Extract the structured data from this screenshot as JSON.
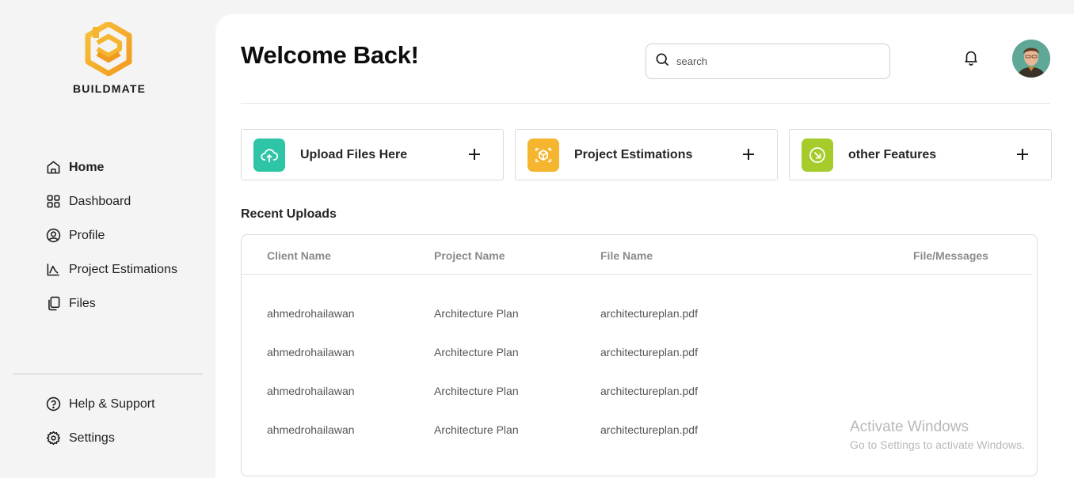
{
  "app": {
    "brand": "BUILDMATE"
  },
  "sidebar": {
    "items": [
      {
        "label": "Home",
        "icon": "home-icon",
        "active": true
      },
      {
        "label": "Dashboard",
        "icon": "dashboard-grid-icon"
      },
      {
        "label": "Profile",
        "icon": "user-circle-icon"
      },
      {
        "label": "Project Estimations",
        "icon": "chart-icon"
      },
      {
        "label": "Files",
        "icon": "files-icon"
      }
    ],
    "bottom_items": [
      {
        "label": "Help & Support",
        "icon": "help-circle-icon"
      },
      {
        "label": "Settings",
        "icon": "gear-icon"
      }
    ]
  },
  "header": {
    "title": "Welcome Back!",
    "search_placeholder": "search"
  },
  "cards": [
    {
      "label": "Upload Files Here",
      "icon": "cloud-upload-icon",
      "color": "#2ec4a6"
    },
    {
      "label": "Project Estimations",
      "icon": "cube-scan-icon",
      "color": "#f5b52e"
    },
    {
      "label": "other Features",
      "icon": "arrow-down-right-circle-icon",
      "color": "#a5cc2a"
    }
  ],
  "recent": {
    "title": "Recent Uploads",
    "columns": [
      "Client Name",
      "Project Name",
      "File Name",
      "File/Messages"
    ],
    "rows": [
      [
        "ahmedrohailawan",
        "Architecture Plan",
        "architectureplan.pdf"
      ],
      [
        "ahmedrohailawan",
        "Architecture Plan",
        "architectureplan.pdf"
      ],
      [
        "ahmedrohailawan",
        "Architecture Plan",
        "architectureplan.pdf"
      ],
      [
        "ahmedrohailawan",
        "Architecture Plan",
        "architectureplan.pdf"
      ]
    ]
  },
  "watermark": {
    "line1": "Activate Windows",
    "line2": "Go to Settings to activate Windows."
  }
}
